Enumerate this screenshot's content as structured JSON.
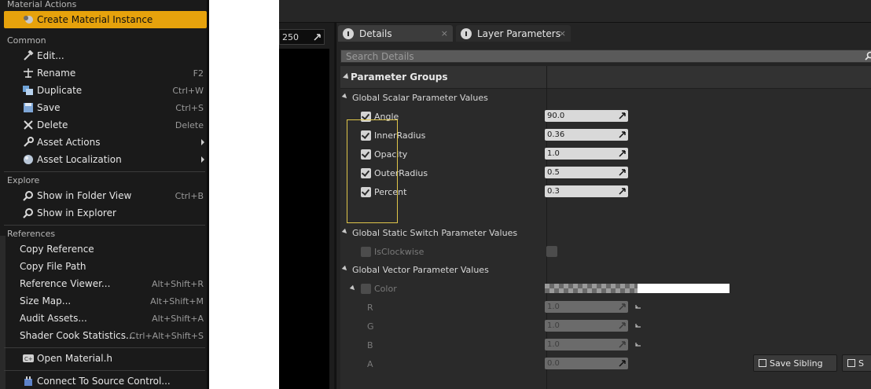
{
  "menu": {
    "sections": {
      "material_actions": "Material Actions",
      "common": "Common",
      "explore": "Explore",
      "references": "References"
    },
    "create_material_instance": "Create Material Instance",
    "edit": "Edit...",
    "rename": "Rename",
    "rename_sc": "F2",
    "duplicate": "Duplicate",
    "duplicate_sc": "Ctrl+W",
    "save": "Save",
    "save_sc": "Ctrl+S",
    "delete": "Delete",
    "delete_sc": "Delete",
    "asset_actions": "Asset Actions",
    "asset_localization": "Asset Localization",
    "show_in_folder_view": "Show in Folder View",
    "show_in_folder_view_sc": "Ctrl+B",
    "show_in_explorer": "Show in Explorer",
    "copy_reference": "Copy Reference",
    "copy_file_path": "Copy File Path",
    "reference_viewer": "Reference Viewer...",
    "reference_viewer_sc": "Alt+Shift+R",
    "size_map": "Size Map...",
    "size_map_sc": "Alt+Shift+M",
    "audit_assets": "Audit Assets...",
    "audit_assets_sc": "Alt+Shift+A",
    "shader_cook_statistics": "Shader Cook Statistics...",
    "shader_cook_statistics_sc": "Ctrl+Alt+Shift+S",
    "open_material_h": "Open Material.h",
    "connect_to_source_control": "Connect To Source Control..."
  },
  "editor": {
    "zoom_value": "250",
    "tabs": [
      "Details",
      "Layer Parameters"
    ],
    "tab_close": "×",
    "search_placeholder": "Search Details",
    "category": "Parameter Groups",
    "groups": {
      "scalar": "Global Scalar Parameter Values",
      "static_switch": "Global Static Switch Parameter Values",
      "vector": "Global Vector Parameter Values"
    },
    "scalar_params": [
      {
        "name": "Angle",
        "value": "90.0"
      },
      {
        "name": "InnerRadius",
        "value": "0.36"
      },
      {
        "name": "Opacity",
        "value": "1.0"
      },
      {
        "name": "OuterRadius",
        "value": "0.5"
      },
      {
        "name": "Percent",
        "value": "0.3"
      }
    ],
    "switch_param": "IsClockwise",
    "color_param": "Color",
    "color_channels": [
      {
        "name": "R",
        "value": "1.0"
      },
      {
        "name": "G",
        "value": "1.0"
      },
      {
        "name": "B",
        "value": "1.0"
      },
      {
        "name": "A",
        "value": "0.0"
      }
    ],
    "save_sibling": "Save Sibling",
    "save_child_partial": "S"
  },
  "colors": {
    "menu_bg": "#1a1a1a",
    "highlight": "#e6a20c",
    "panel_bg": "#242424",
    "field_bg": "#d9d9d9",
    "selection_outline": "#e0c64a"
  }
}
